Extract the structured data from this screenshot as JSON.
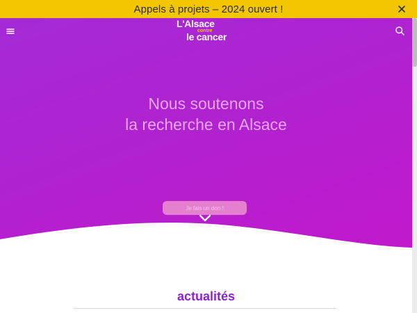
{
  "banner": {
    "text": "Appels à projets – 2024 ouvert !",
    "background": "#f2c600"
  },
  "header": {
    "menu_icon": "hamburger-menu-icon",
    "search_icon": "search-icon",
    "logo": {
      "line1": "L'Alsace",
      "middle": "contre",
      "line2": "le cancer"
    }
  },
  "hero": {
    "title_line1": "Nous soutenons",
    "title_line2": "la recherche en Alsace",
    "donate_label": "Je fais un don !",
    "scroll_icon": "chevron-down-icon",
    "gradient_colors": [
      "#a42bd6",
      "#c118cc"
    ]
  },
  "news": {
    "title": "actualités",
    "title_color": "#8e22d3"
  }
}
